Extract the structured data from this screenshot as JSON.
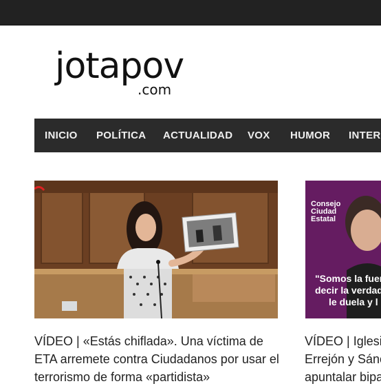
{
  "site": {
    "logo_main": "jotapov",
    "logo_suffix": ".com"
  },
  "nav": {
    "items": [
      {
        "label": "INICIO"
      },
      {
        "label": "POLÍTICA"
      },
      {
        "label": "ACTUALIDAD"
      },
      {
        "label": "VOX"
      },
      {
        "label": "HUMOR"
      },
      {
        "label": "INTERN"
      }
    ]
  },
  "articles": [
    {
      "image_icon": "parliament-speaker-photo",
      "headline": "VÍDEO | «Estás chiflada». Una víctima de ETA arremete contra Ciudadanos por usar el terrorismo de forma «partidista»"
    },
    {
      "image_icon": "pablo-iglesias-promo-photo",
      "image_overlay": {
        "badge_line1": "Consejo",
        "badge_line2": "Ciudad",
        "badge_line3": "Estatal",
        "quote_line1": "\"Somos la fuer",
        "quote_line2": "decir la verdad",
        "quote_line3": "le duela y l"
      },
      "headline_lines": [
        "VÍDEO | Iglesia",
        "Errejón y Sánc",
        "apuntalar bipa"
      ]
    }
  ],
  "colors": {
    "topbar": "#222222",
    "nav_bg": "#2b2b2b",
    "nav_text": "#f0f0f0",
    "headline_text": "#222222"
  }
}
